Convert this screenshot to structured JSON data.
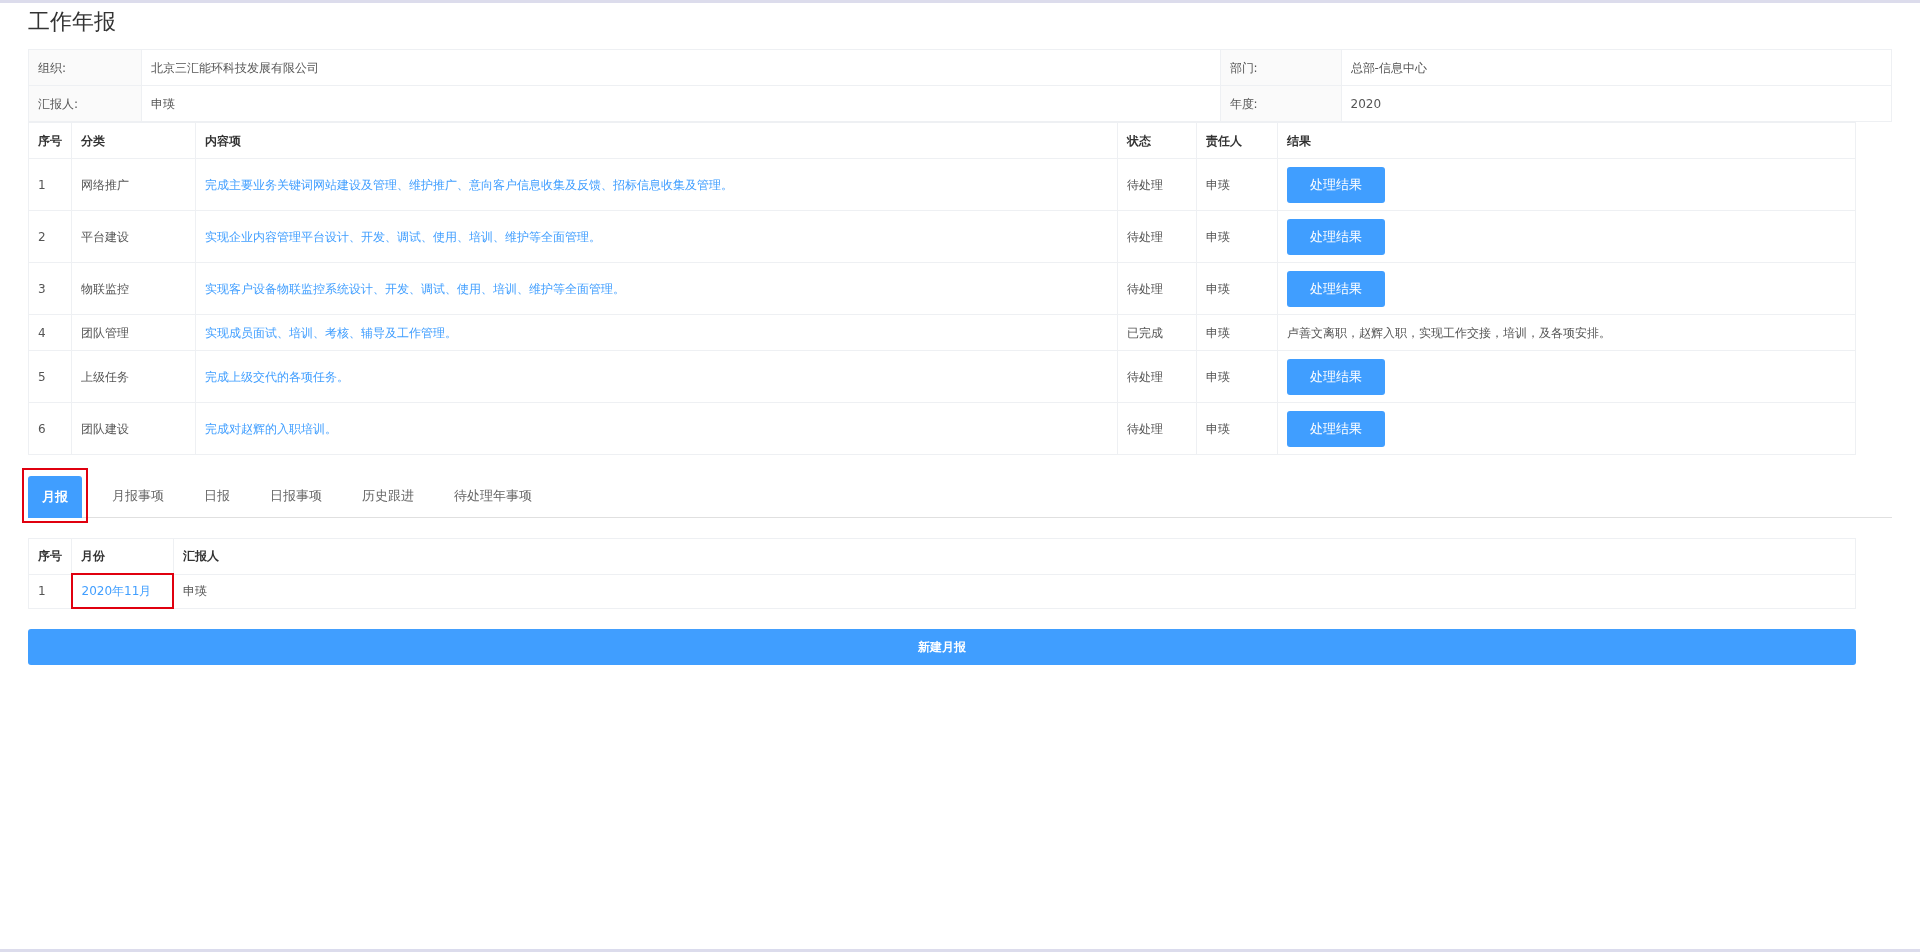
{
  "page_title": "工作年报",
  "info": [
    {
      "label": "组织:",
      "value": "北京三汇能环科技发展有限公司"
    },
    {
      "label": "部门:",
      "value": "总部-信息中心"
    },
    {
      "label": "汇报人:",
      "value": "申瑛"
    },
    {
      "label": "年度:",
      "value": "2020"
    }
  ],
  "items_table": {
    "columns": [
      "序号",
      "分类",
      "内容项",
      "状态",
      "责任人",
      "结果"
    ],
    "rows": [
      {
        "index": "1",
        "category": "网络推广",
        "content": "完成主要业务关键词网站建设及管理、维护推广、意向客户信息收集及反馈、招标信息收集及管理。",
        "status": "待处理",
        "owner": "申瑛",
        "result": {
          "kind": "button",
          "text": "处理结果"
        }
      },
      {
        "index": "2",
        "category": "平台建设",
        "content": "实现企业内容管理平台设计、开发、调试、使用、培训、维护等全面管理。",
        "status": "待处理",
        "owner": "申瑛",
        "result": {
          "kind": "button",
          "text": "处理结果"
        }
      },
      {
        "index": "3",
        "category": "物联监控",
        "content": "实现客户设备物联监控系统设计、开发、调试、使用、培训、维护等全面管理。",
        "status": "待处理",
        "owner": "申瑛",
        "result": {
          "kind": "button",
          "text": "处理结果"
        }
      },
      {
        "index": "4",
        "category": "团队管理",
        "content": "实现成员面试、培训、考核、辅导及工作管理。",
        "status": "已完成",
        "owner": "申瑛",
        "result": {
          "kind": "text",
          "text": "卢善文离职，赵辉入职，实现工作交接，培训，及各项安排。"
        }
      },
      {
        "index": "5",
        "category": "上级任务",
        "content": "完成上级交代的各项任务。",
        "status": "待处理",
        "owner": "申瑛",
        "result": {
          "kind": "button",
          "text": "处理结果"
        }
      },
      {
        "index": "6",
        "category": "团队建设",
        "content": "完成对赵辉的入职培训。",
        "status": "待处理",
        "owner": "申瑛",
        "result": {
          "kind": "button",
          "text": "处理结果"
        }
      }
    ]
  },
  "tabs": [
    {
      "label": "月报",
      "selected": true,
      "highlighted": true
    },
    {
      "label": "月报事项",
      "selected": false,
      "highlighted": false
    },
    {
      "label": "日报",
      "selected": false,
      "highlighted": false
    },
    {
      "label": "日报事项",
      "selected": false,
      "highlighted": false
    },
    {
      "label": "历史跟进",
      "selected": false,
      "highlighted": false
    },
    {
      "label": "待处理年事项",
      "selected": false,
      "highlighted": false
    }
  ],
  "monthly_table": {
    "columns": [
      "序号",
      "月份",
      "汇报人"
    ],
    "rows": [
      {
        "index": "1",
        "month": "2020年11月",
        "month_highlighted": true,
        "reporter": "申瑛"
      }
    ]
  },
  "new_button": "新建月报"
}
